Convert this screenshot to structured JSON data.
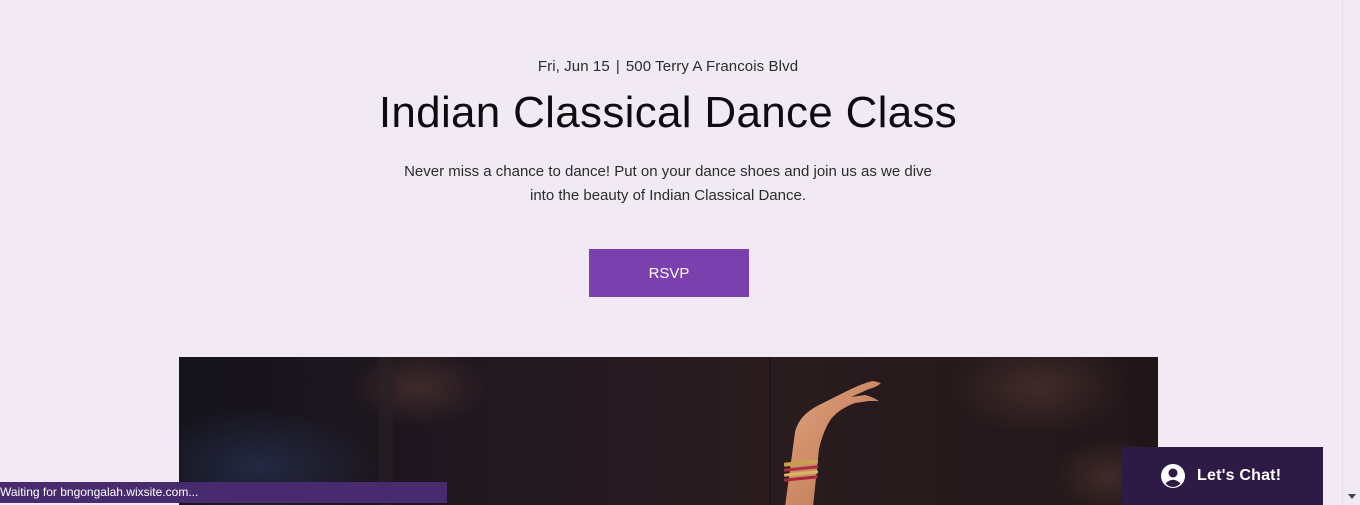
{
  "event": {
    "date": "Fri, Jun 15",
    "separator": "|",
    "location": "500 Terry A Francois Blvd",
    "title": "Indian Classical Dance Class",
    "description": "Never miss a chance to dance! Put on your dance shoes and join us as we dive into the beauty of Indian Classical Dance.",
    "rsvp_label": "RSVP"
  },
  "hero": {
    "icon": "dancer-hand-photo"
  },
  "chat": {
    "label": "Let's Chat!",
    "icon": "user-avatar-icon"
  },
  "status_bar": {
    "text": "Waiting for bngongalah.wixsite.com..."
  },
  "colors": {
    "background": "#f1eaf5",
    "accent": "#7a40ae",
    "chat_bg": "#2d1a45",
    "status_bg": "#482a6e"
  }
}
